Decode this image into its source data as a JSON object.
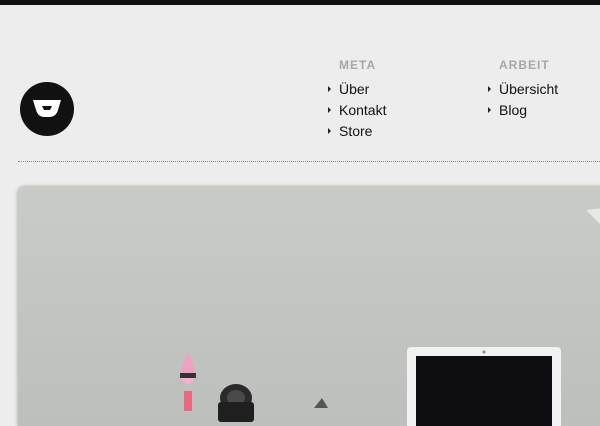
{
  "header": {
    "logo_icon": "w-logo-icon"
  },
  "nav": {
    "meta": {
      "heading": "META",
      "items": [
        {
          "label": "Über"
        },
        {
          "label": "Kontakt"
        },
        {
          "label": "Store"
        }
      ]
    },
    "arbeit": {
      "heading": "ARBEIT",
      "items": [
        {
          "label": "Übersicht"
        },
        {
          "label": "Blog"
        }
      ]
    }
  },
  "colors": {
    "background": "#ededed",
    "top_bar": "#111111",
    "heading": "#a7a7a7",
    "text": "#111111",
    "photo_wall": "#c6c8c4"
  }
}
